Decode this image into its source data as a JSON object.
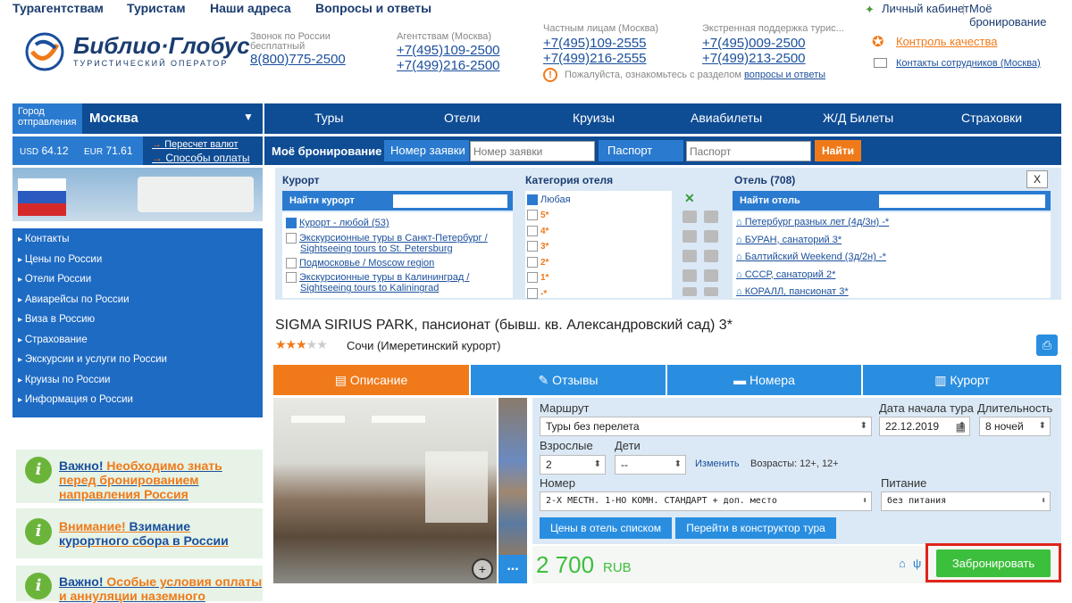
{
  "topnav": {
    "agencies": "Турагентствам",
    "tourists": "Туристам",
    "addresses": "Наши адреса",
    "faq": "Вопросы и ответы",
    "cabinet": "Личный кабинет",
    "mybooking": "Моё бронирование"
  },
  "logo": {
    "name": "Библио·Глобус",
    "tagline": "ТУРИСТИЧЕСКИЙ ОПЕРАТОР"
  },
  "contacts": {
    "free_label": "Звонок по России бесплатный",
    "free_phone": "8(800)775-2500",
    "agency_label": "Агентствам (Москва)",
    "agency_phone1": "+7(495)109-2500",
    "agency_phone2": "+7(499)216-2500",
    "private_label": "Частным лицам (Москва)",
    "private_phone1": "+7(495)109-2555",
    "private_phone2": "+7(499)216-2555",
    "support_label": "Экстренная поддержка турис...",
    "support_phone1": "+7(495)009-2500",
    "support_phone2": "+7(499)213-2500",
    "faq_note": "Пожалуйста, ознакомьтесь с разделом",
    "faq_link": "вопросы и ответы",
    "quality": "Контроль качества",
    "staff": "Контакты сотрудников (Москва)"
  },
  "city": {
    "label": "Город отправления",
    "value": "Москва"
  },
  "mainnav": [
    "Туры",
    "Отели",
    "Круизы",
    "Авиабилеты",
    "Ж/Д Билеты",
    "Страховки"
  ],
  "currency": {
    "usd_label": "USD",
    "usd": "64.12",
    "eur_label": "EUR",
    "eur": "71.61",
    "recalc": "Пересчет валют",
    "payment": "Способы оплаты"
  },
  "booking": {
    "title": "Моё бронирование",
    "order_label": "Номер заявки",
    "order_placeholder": "Номер заявки",
    "passport_label": "Паспорт",
    "passport_placeholder": "Паспорт",
    "find": "Найти"
  },
  "sidemenu": [
    "Контакты",
    "Цены по России",
    "Отели России",
    "Авиарейсы по России",
    "Виза в Россию",
    "Страхование",
    "Экскурсии и услуги по России",
    "Круизы по России",
    "Информация о России"
  ],
  "notes": [
    {
      "a": "Важно!",
      "b": "Необходимо знать перед бронированием направления Россия"
    },
    {
      "a": "Внимание!",
      "b": "Взимание курортного сбора в России"
    },
    {
      "a": "Важно!",
      "b": "Особые условия оплаты и аннуляции наземного"
    }
  ],
  "filter": {
    "resort_title": "Курорт",
    "resort_find": "Найти курорт",
    "resorts": [
      "Курорт - любой (53)",
      "Экскурсионные туры в Санкт-Петербург / Sightseeing tours to St. Petersburg",
      "Подмосковье / Moscow region",
      "Экскурсионные туры в Калининград / Sightseeing tours to Kaliningrad"
    ],
    "cat_title": "Категория отеля",
    "cats": [
      "Любая",
      "5*",
      "4*",
      "3*",
      "2*",
      "1*",
      "-*"
    ],
    "hotel_title": "Отель (708)",
    "hotel_find": "Найти отель",
    "hotels": [
      "Петербург разных лет (4д/3н) -*",
      "БУРАН, санаторий 3*",
      "Балтийский Weekend (3д/2н) -*",
      "СССР, санаторий 2*",
      "КОРАЛЛ, пансионат 3*"
    ],
    "close": "X"
  },
  "hotel": {
    "name": "SIGMA SIRIUS PARK, пансионат (бывш. кв. Александровский сад) 3*",
    "location": "Сочи (Имеретинский курорт)",
    "stars": 3
  },
  "tabs": [
    "Описание",
    "Отзывы",
    "Номера",
    "Курорт"
  ],
  "form": {
    "route_label": "Маршрут",
    "route": "Туры без перелета",
    "date_label": "Дата начала тура",
    "date": "22.12.2019",
    "dur_label": "Длительность",
    "dur": "8 ночей",
    "adults_label": "Взрослые",
    "adults": "2",
    "kids_label": "Дети",
    "kids": "--",
    "change": "Изменить",
    "ages": "Возрасты: 12+, 12+",
    "room_label": "Номер",
    "room": "2-Х МЕСТН. 1-НО КОМН. СТАНДАРТ + доп. место",
    "meal_label": "Питание",
    "meal": "без питания",
    "btn_list": "Цены в отель списком",
    "btn_constructor": "Перейти в конструктор тура",
    "price": "2 700",
    "currency": "RUB",
    "book": "Забронировать",
    "more": "..."
  }
}
